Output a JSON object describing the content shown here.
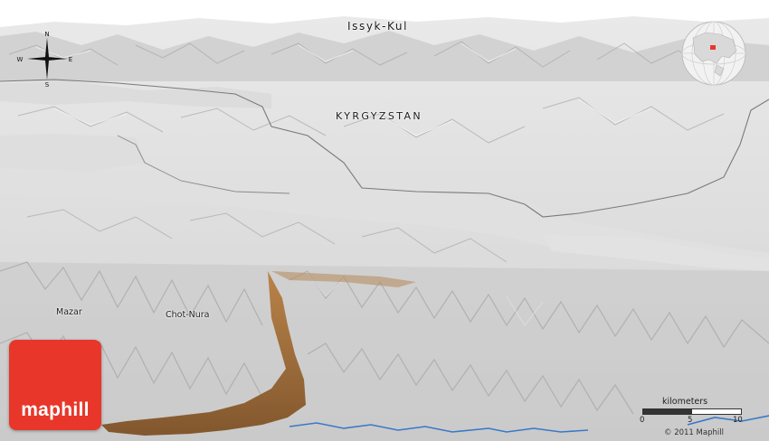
{
  "map": {
    "place_labels": {
      "lake": "Issyk-Kul",
      "country": "KYRGYZSTAN",
      "town_west": "Mazar",
      "town_central": "Chot-Nura"
    },
    "compass": {
      "north": "N",
      "south": "S",
      "east": "E",
      "west": "W"
    },
    "scale": {
      "title": "kilometers",
      "tick_0": "0",
      "tick_5": "5",
      "tick_10": "10"
    },
    "brand": {
      "logo_text": "maphill",
      "logo_color": "#e8372a"
    },
    "copyright": "© 2011 Maphill",
    "colors": {
      "relief_base": "#d6d6d6",
      "valley": "#dedede",
      "lowland_brown": "#a86a2c",
      "border_line": "#7a7a7a",
      "river": "#3a78c8",
      "globe_highlight": "#e8372a"
    }
  }
}
